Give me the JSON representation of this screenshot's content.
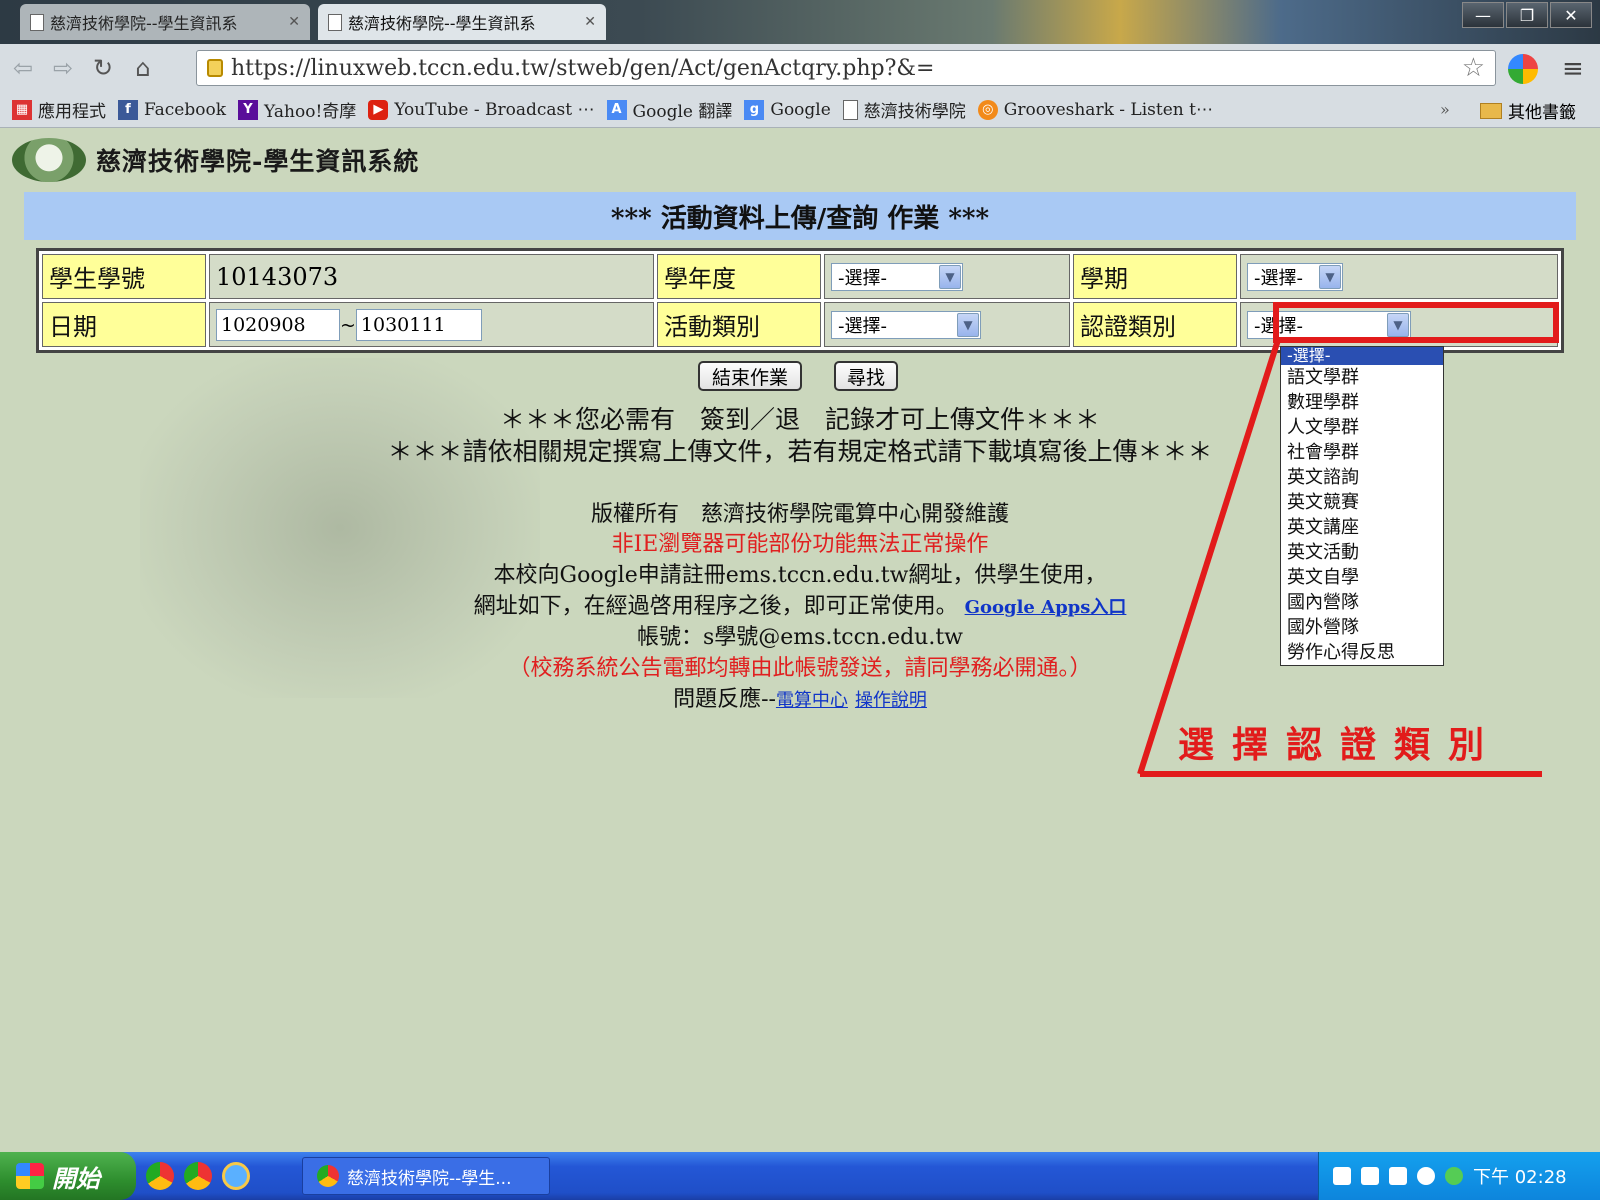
{
  "browser": {
    "tabs": [
      {
        "label": "慈濟技術學院--學生資訊系"
      },
      {
        "label": "慈濟技術學院--學生資訊系"
      }
    ],
    "window_buttons": {
      "minimize": "—",
      "restore": "❐",
      "close": "✕"
    },
    "url": "https://linuxweb.tccn.edu.tw/stweb/gen/Act/genActqry.php?&=",
    "bookmarks": [
      {
        "label": "應用程式",
        "icon": "apps-icon",
        "color": "#d33"
      },
      {
        "label": "Facebook",
        "icon": "facebook-icon",
        "color": "#3b5998"
      },
      {
        "label": "Yahoo!奇摩",
        "icon": "yahoo-icon",
        "color": "#5a0e9a"
      },
      {
        "label": "YouTube - Broadcast ⋯",
        "icon": "youtube-icon",
        "color": "#d21"
      },
      {
        "label": "Google 翻譯",
        "icon": "translate-icon",
        "color": "#4a8af4"
      },
      {
        "label": "Google",
        "icon": "google-icon",
        "color": "#4a8af4"
      },
      {
        "label": "慈濟技術學院",
        "icon": "page-icon",
        "color": "#fff"
      },
      {
        "label": "Grooveshark - Listen t⋯",
        "icon": "grooveshark-icon",
        "color": "#f28a1a"
      }
    ],
    "bookmarks_more": "»",
    "other_bookmarks": "其他書籤"
  },
  "page": {
    "logo_title": "慈濟技術學院-學生資訊系統",
    "banner": "*** 活動資料上傳/查詢 作業 ***",
    "form": {
      "student_id_label": "學生學號",
      "student_id_value": "10143073",
      "year_label": "學年度",
      "year_value": "-選擇-",
      "semester_label": "學期",
      "semester_value": "-選擇-",
      "date_label": "日期",
      "date_from": "1020908",
      "date_sep": "~",
      "date_to": "1030111",
      "activity_type_label": "活動類別",
      "activity_type_value": "-選擇-",
      "cert_type_label": "認證類別",
      "cert_type_value": "-選擇-"
    },
    "cert_options": [
      "-選擇-",
      "語文學群",
      "數理學群",
      "人文學群",
      "社會學群",
      "英文諮詢",
      "英文競賽",
      "英文講座",
      "英文活動",
      "英文自學",
      "國內營隊",
      "國外營隊",
      "勞作心得反思"
    ],
    "buttons": {
      "end": "結束作業",
      "search": "尋找"
    },
    "notice1": "＊＊＊您必需有　簽到／退　記錄才可上傳文件＊＊＊",
    "notice2": "＊＊＊請依相關規定撰寫上傳文件，若有規定格式請下載填寫後上傳＊＊＊",
    "copyright": "版權所有　慈濟技術學院電算中心開發維護",
    "browser_warning": "非IE瀏覽器可能部份功能無法正常操作",
    "google_line1": "本校向Google申請註冊ems.tccn.edu.tw網址，供學生使用，",
    "google_line2": "網址如下，在經過啓用程序之後，即可正常使用。",
    "google_apps_link": "Google Apps入口",
    "account_line": "帳號：s學號@ems.tccn.edu.tw",
    "mail_note": "（校務系統公告電郵均轉由此帳號發送，請同學務必開通。）",
    "feedback_prefix": "問題反應--",
    "feedback_link1": "電算中心",
    "feedback_link2": "操作說明",
    "annotation": "選擇認證類別",
    "annotation_color": "#e21b1b"
  },
  "taskbar": {
    "start": "開始",
    "task": "慈濟技術學院--學生...",
    "clock": "下午 02:28"
  }
}
